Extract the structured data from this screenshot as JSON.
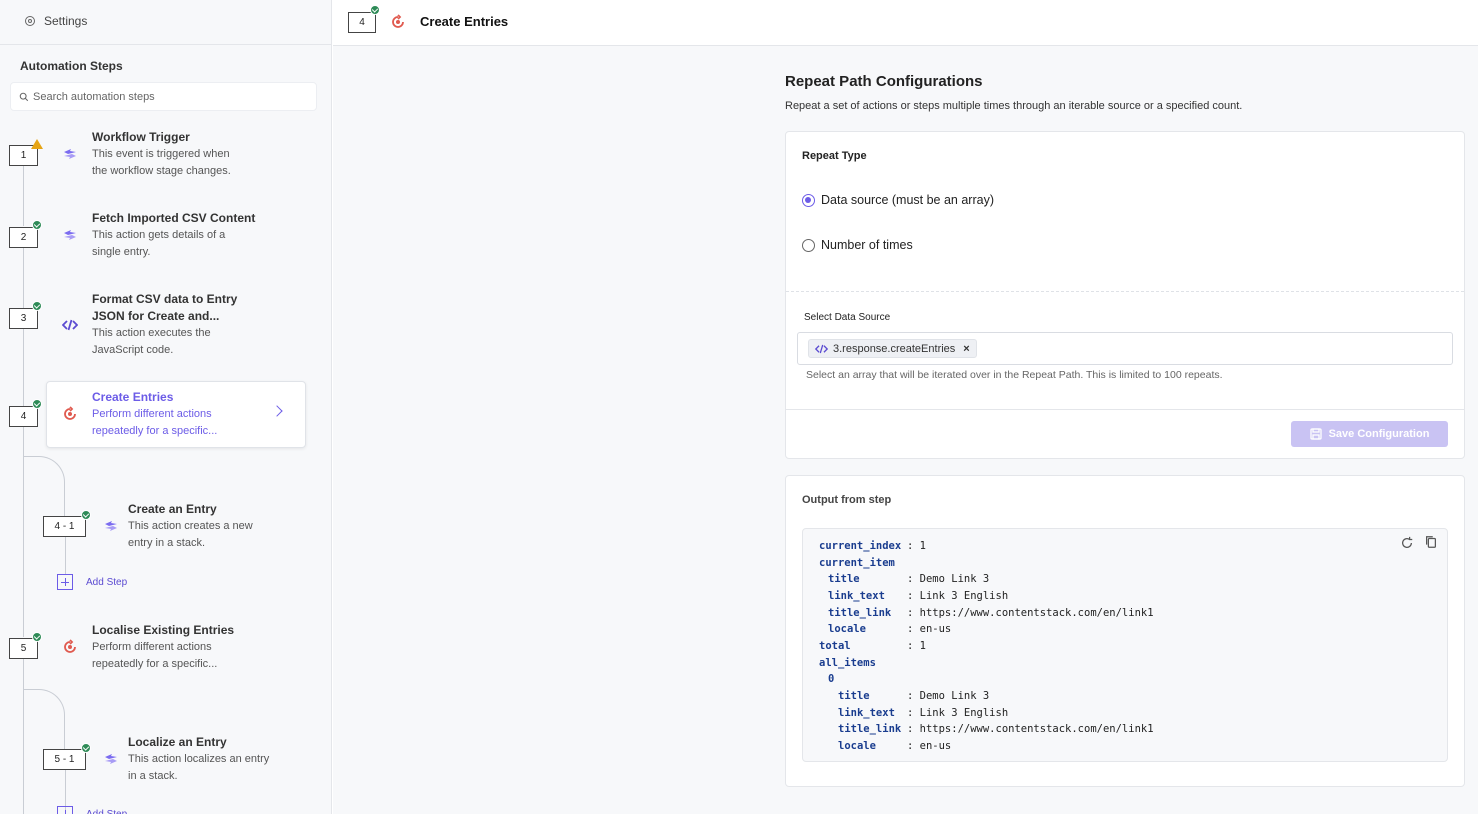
{
  "sidebar": {
    "settings_label": "Settings",
    "section_title": "Automation Steps",
    "search_placeholder": "Search automation steps",
    "steps": [
      {
        "num": "1",
        "title": "Workflow Trigger",
        "desc_lines": [
          "This event is triggered when",
          "the workflow stage changes."
        ],
        "status": "warning",
        "icon": "sync-icon"
      },
      {
        "num": "2",
        "title": "Fetch Imported CSV Content",
        "desc_lines": [
          "This action gets details of a",
          "single entry."
        ],
        "status": "success",
        "icon": "sync-icon"
      },
      {
        "num": "3",
        "title_lines": [
          "Format CSV data to Entry",
          "JSON for Create and..."
        ],
        "desc_lines": [
          "This action executes the",
          "JavaScript code."
        ],
        "status": "success",
        "icon": "code-icon"
      },
      {
        "num": "4",
        "title": "Create Entries",
        "desc_lines": [
          "Perform different actions",
          "repeatedly for a specific..."
        ],
        "status": "success",
        "icon": "repeat-icon",
        "active": true
      },
      {
        "num": "4 - 1",
        "title": "Create an Entry",
        "desc_lines": [
          "This action creates a new",
          "entry in a stack."
        ],
        "status": "success",
        "icon": "sync-icon"
      },
      {
        "num": "5",
        "title": "Localise Existing Entries",
        "desc_lines": [
          "Perform different actions",
          "repeatedly for a specific..."
        ],
        "status": "success",
        "icon": "repeat-icon"
      },
      {
        "num": "5 - 1",
        "title": "Localize an Entry",
        "desc_lines": [
          "This action localizes an entry",
          "in a stack."
        ],
        "status": "success",
        "icon": "sync-icon"
      }
    ],
    "add_step_label": "Add Step"
  },
  "header": {
    "step_num": "4",
    "title": "Create Entries"
  },
  "main": {
    "title": "Repeat Path Configurations",
    "subtitle": "Repeat a set of actions or steps multiple times through an iterable source or a specified count.",
    "repeat_type_label": "Repeat Type",
    "options": [
      {
        "label": "Data source (must be an array)",
        "selected": true
      },
      {
        "label": "Number of times",
        "selected": false
      }
    ],
    "data_source_label": "Select Data Source",
    "data_source_value": "3.response.createEntries",
    "data_source_help": "Select an array that will be iterated over in the Repeat Path. This is limited to 100 repeats.",
    "save_label": "Save Configuration",
    "output_label": "Output from step",
    "output": [
      {
        "key": "current_index",
        "value": ": 1",
        "indent": 0
      },
      {
        "key": "current_item",
        "value": "",
        "indent": 0
      },
      {
        "key": "title",
        "value": ": Demo Link 3",
        "indent": 1
      },
      {
        "key": "link_text",
        "value": ": Link 3 English",
        "indent": 1
      },
      {
        "key": "title_link",
        "value": ": https://www.contentstack.com/en/link1",
        "indent": 1
      },
      {
        "key": "locale",
        "value": ": en-us",
        "indent": 1
      },
      {
        "key": "total",
        "value": ": 1",
        "indent": 0
      },
      {
        "key": "all_items",
        "value": "",
        "indent": 0
      },
      {
        "key": "0",
        "value": "",
        "indent": 1
      },
      {
        "key": "title",
        "value": ": Demo Link 3",
        "indent": 2
      },
      {
        "key": "link_text",
        "value": ": Link 3 English",
        "indent": 2
      },
      {
        "key": "title_link",
        "value": ": https://www.contentstack.com/en/link1",
        "indent": 2
      },
      {
        "key": "locale",
        "value": ": en-us",
        "indent": 2
      }
    ]
  },
  "colors": {
    "accent": "#6c5ce7",
    "success": "#2e8b57",
    "warning": "#e6a516",
    "repeat": "#e05a4f",
    "code_key": "#1a3d8f"
  }
}
